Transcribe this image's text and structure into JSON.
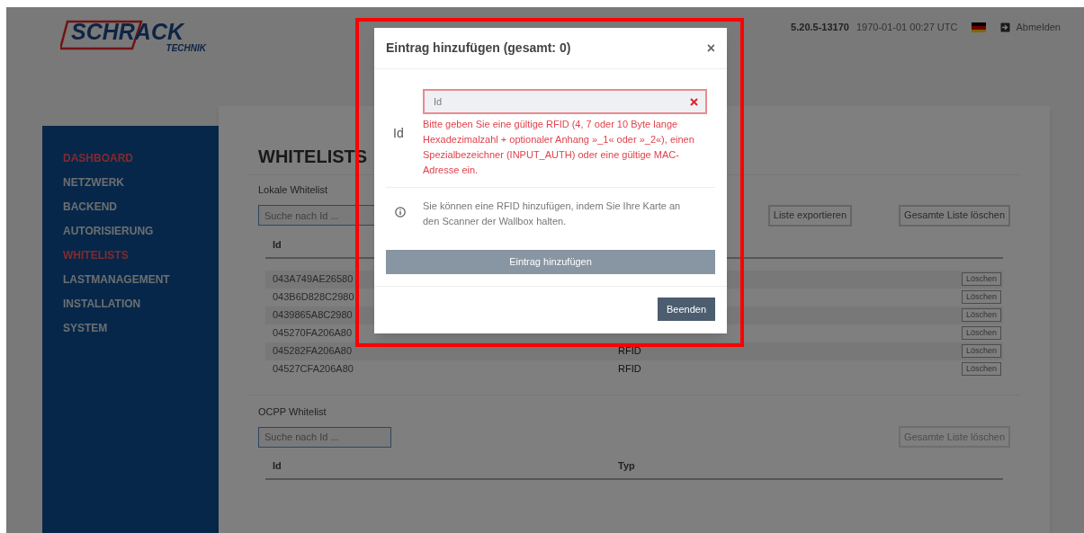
{
  "logo": {
    "line1": "SCHRACK",
    "line2": "TECHNIK"
  },
  "header": {
    "version": "5.20.5-13170",
    "datetime": "1970-01-01 00:27 UTC",
    "logout": "Abmelden"
  },
  "sidebar": {
    "items": [
      {
        "label": "DASHBOARD",
        "selected": true
      },
      {
        "label": "NETZWERK",
        "selected": false
      },
      {
        "label": "BACKEND",
        "selected": false
      },
      {
        "label": "AUTORISIERUNG",
        "selected": false
      },
      {
        "label": "WHITELISTS",
        "selected": true
      },
      {
        "label": "LASTMANAGEMENT",
        "selected": false
      },
      {
        "label": "INSTALLATION",
        "selected": false
      },
      {
        "label": "SYSTEM",
        "selected": false
      }
    ]
  },
  "page": {
    "title": "WHITELISTS"
  },
  "local_whitelist": {
    "label": "Lokale Whitelist",
    "search": {
      "placeholder": "Suche nach Id ..."
    },
    "buttons": [
      "Liste exportieren",
      "Gesamte Liste löschen"
    ],
    "columns": [
      "Id"
    ],
    "rows": [
      {
        "id": "043A749AE26580",
        "delete": "Löschen"
      },
      {
        "id": "043B6D828C2980",
        "delete": "Löschen"
      },
      {
        "id": "0439865A8C2980",
        "delete": "Löschen"
      },
      {
        "id": "045270FA206A80",
        "delete": "Löschen"
      },
      {
        "id": "045282FA206A80",
        "typ": "RFID",
        "delete": "Löschen"
      },
      {
        "id": "04527CFA206A80",
        "typ": "RFID",
        "delete": "Löschen"
      }
    ]
  },
  "ocpp_whitelist": {
    "label": "OCPP Whitelist",
    "search": {
      "placeholder": "Suche nach Id ..."
    },
    "buttons": [
      "Gesamte Liste löschen"
    ],
    "columns": [
      "Id",
      "Typ"
    ]
  },
  "dialog": {
    "title": "Eintrag hinzufügen (gesamt: 0)",
    "close": "×",
    "field_label": "Id",
    "field": {
      "placeholder": "Id",
      "invalid": true
    },
    "error": "Bitte geben Sie eine gültige RFID (4, 7 oder 10 Byte lange Hexadezimalzahl + optionaler Anhang »_1« oder »_2«), einen Spezialbezeichner (INPUT_AUTH) oder eine gültige MAC-Adresse ein.",
    "info": "Sie können eine RFID hinzufügen, indem Sie Ihre Karte an den Scanner der Wallbox halten.",
    "add_button": "Eintrag hinzufügen",
    "close_button": "Beenden"
  }
}
